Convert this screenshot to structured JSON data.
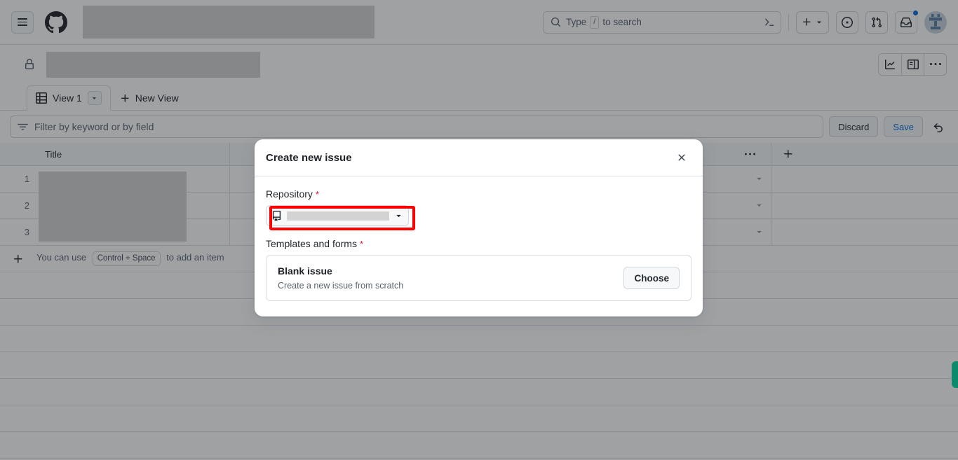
{
  "header": {
    "menu_icon": "hamburger-menu-icon",
    "logo_icon": "github-logo-icon",
    "title_redacted": true,
    "search": {
      "placeholder_prefix": "Type",
      "slash_key": "/",
      "placeholder_suffix": "to search",
      "terminal_icon": "terminal-icon"
    },
    "create_new_label": "+",
    "icons": {
      "issues": "issue-opened-icon",
      "pull_requests": "git-pull-request-icon",
      "inbox": "inbox-icon",
      "avatar": "user-avatar"
    },
    "has_notification": true,
    "notification_color": "#0969da"
  },
  "project": {
    "visibility_icon": "lock-icon",
    "name_redacted": true,
    "actions": {
      "insights": "graph-icon",
      "toggle_sidebar": "sidebar-expand-icon",
      "more": "kebab-horizontal-icon"
    }
  },
  "view_tabs": {
    "tabs": [
      {
        "label": "View 1",
        "icon": "table-icon",
        "active": true,
        "caret": "chevron-down-icon"
      }
    ],
    "new_view_label": "New View",
    "new_view_icon": "plus-icon"
  },
  "filter_bar": {
    "icon": "filter-icon",
    "placeholder": "Filter by keyword or by field",
    "discard_label": "Discard",
    "save_label": "Save",
    "undo_icon": "undo-icon",
    "save_color": "#0969da"
  },
  "table": {
    "columns": [
      {
        "label": "Title"
      }
    ],
    "header_more_icon": "kebab-horizontal-icon",
    "add_column_icon": "plus-icon",
    "rows": [
      {
        "number": "1",
        "title_redacted": true,
        "caret": "triangle-down-icon"
      },
      {
        "number": "2",
        "title_redacted": true,
        "caret": "triangle-down-icon"
      },
      {
        "number": "3",
        "title_redacted": true,
        "caret": "triangle-down-icon"
      }
    ],
    "add_item": {
      "icon": "plus-icon",
      "text_before": "You can use",
      "shortcut": "Control + Space",
      "text_after": "to add an item"
    },
    "empty_row_count": 7,
    "side_marker_color": "#00d9a0"
  },
  "modal": {
    "title": "Create new issue",
    "close_icon": "close-icon",
    "repository": {
      "label": "Repository",
      "required_mark": "*",
      "icon": "repo-icon",
      "value_redacted": true,
      "caret": "triangle-down-icon",
      "highlighted": true,
      "highlight_color": "#ff0000"
    },
    "templates": {
      "label": "Templates and forms",
      "required_mark": "*",
      "items": [
        {
          "name": "Blank issue",
          "description": "Create a new issue from scratch",
          "button_label": "Choose"
        }
      ]
    }
  }
}
